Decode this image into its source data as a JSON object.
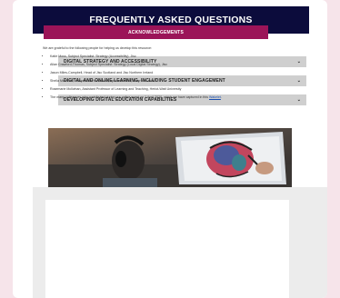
{
  "faq": {
    "title": "FREQUENTLY ASKED QUESTIONS"
  },
  "accordion": [
    {
      "label": "DIGITAL STRATEGY AND ACCESSIBILITY"
    },
    {
      "label": "DIGITAL AND ONLINE LEARNING, INCLUDING STUDENT ENGAGEMENT"
    },
    {
      "label": "DEVELOPING DIGITAL EDUCATION CAPABILITIES"
    }
  ],
  "acknowledgements": {
    "title": "ACKNOWLEDGEMENTS",
    "intro": "We are grateful to the following people for helping us develop this resource:",
    "people": [
      "Katie Moss, Subject Specialist: Strategy (Accessibility), Jisc",
      "Allan Crawford-Thomas, Subject Specialist: Strategy (Local Digital Strategy), Jisc",
      "Jason Miles-Campbell, Head of Jisc Scotland and Jisc Northern Ireland",
      "Sheila MacNeill, Independent consultant, open educator, writer and artist",
      "Rosemarie McIlwhan, Assistant Professor of Learning and Teaching, Heriot-Watt University"
    ],
    "last_item_prefix": "The many colleagues who contributed during our online event on 1 April 2020, which we have captured in this",
    "last_item_link": "Wakelet",
    "last_item_suffix": "."
  },
  "colors": {
    "header_bg": "#0c0c3c",
    "accordion_bg": "#cfcfcf",
    "ack_bar_bg": "#9b1458",
    "page_bg": "#f6e4ea"
  }
}
